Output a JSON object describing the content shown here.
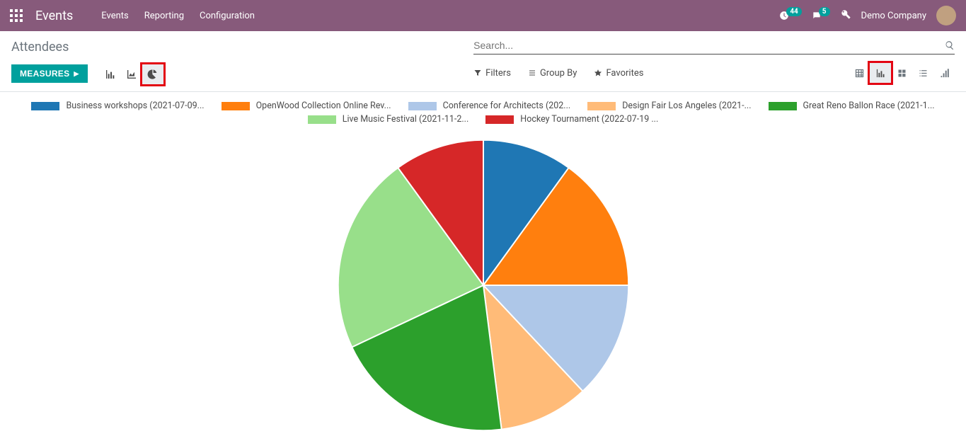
{
  "nav": {
    "brand": "Events",
    "links": [
      "Events",
      "Reporting",
      "Configuration"
    ],
    "activity_count": "44",
    "chat_count": "5",
    "company": "Demo Company"
  },
  "page": {
    "title": "Attendees",
    "measures_label": "MEASURES",
    "search_placeholder": "Search...",
    "filters_label": "Filters",
    "groupby_label": "Group By",
    "favorites_label": "Favorites"
  },
  "chart_data": {
    "type": "pie",
    "title": "",
    "series": [
      {
        "name": "Business workshops (2021-07-09...",
        "value": 10,
        "color": "#1f77b4"
      },
      {
        "name": "OpenWood Collection Online Rev...",
        "value": 15,
        "color": "#ff7f0e"
      },
      {
        "name": "Conference for Architects (202...",
        "value": 13,
        "color": "#aec7e8"
      },
      {
        "name": "Design Fair Los Angeles (2021-...",
        "value": 10,
        "color": "#ffbb78"
      },
      {
        "name": "Great Reno Ballon Race (2021-1...",
        "value": 20,
        "color": "#2ca02c"
      },
      {
        "name": "Live Music Festival (2021-11-2...",
        "value": 22,
        "color": "#98df8a"
      },
      {
        "name": "Hockey Tournament (2022-07-19 ...",
        "value": 10,
        "color": "#d62728"
      }
    ]
  }
}
